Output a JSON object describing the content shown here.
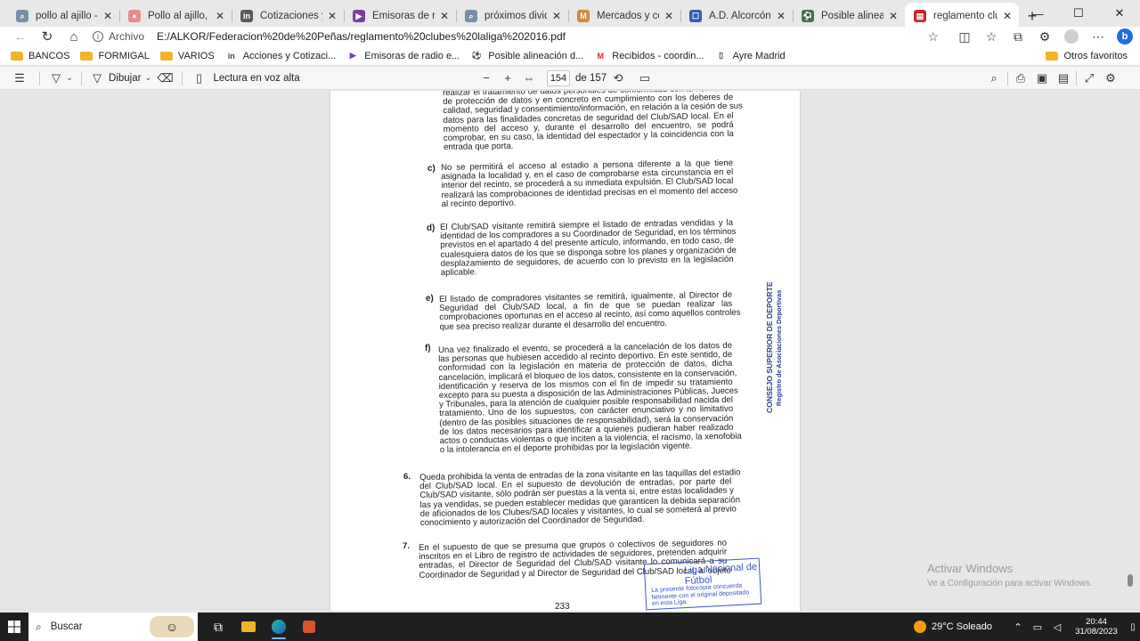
{
  "tabs": [
    {
      "label": "pollo al ajillo - Búsqueda",
      "icon": "search-icon",
      "favcolor": "#7a8fa6",
      "glyph": "⌕"
    },
    {
      "label": "Pollo al ajillo, receta ca",
      "icon": "recipe-site-icon",
      "favcolor": "#e98b8b",
      "glyph": "●"
    },
    {
      "label": "Cotizaciones y Precios",
      "icon": "investing-icon",
      "favcolor": "#5a5a5a",
      "glyph": "in"
    },
    {
      "label": "Emisoras de radio",
      "icon": "radio-icon",
      "favcolor": "#7b3fa0",
      "glyph": "▶"
    },
    {
      "label": "próximos dividendos",
      "icon": "search-icon",
      "favcolor": "#7a8fa6",
      "glyph": "⌕"
    },
    {
      "label": "Mercados y cotizaciones",
      "icon": "markets-icon",
      "favcolor": "#d08a3a",
      "glyph": "M"
    },
    {
      "label": "A.D. Alcorcón (no oficial)",
      "icon": "forum-icon",
      "favcolor": "#2f5fb3",
      "glyph": "☐"
    },
    {
      "label": "Posible alineación del",
      "icon": "soccer-ball-icon",
      "favcolor": "#3b7a3b",
      "glyph": "⚽"
    },
    {
      "label": "reglamento clubes laliga",
      "icon": "pdf-icon",
      "favcolor": "#c62828",
      "glyph": "▤"
    }
  ],
  "window_controls": {
    "minimize": "—",
    "maximize": "☐",
    "close": "✕"
  },
  "address": {
    "scheme": "Archivo",
    "url": "E:/ALKOR/Federacion%20de%20Peñas/reglamento%20clubes%20laliga%202016.pdf"
  },
  "bookmarks": [
    {
      "label": "BANCOS",
      "icon": "folder-icon"
    },
    {
      "label": "FORMIGAL",
      "icon": "folder-icon"
    },
    {
      "label": "VARIOS",
      "icon": "folder-icon"
    },
    {
      "label": "Acciones y Cotizaci...",
      "icon": "investing-icon"
    },
    {
      "label": "Emisoras de radio e...",
      "icon": "radio-icon"
    },
    {
      "label": "Posible alineación d...",
      "icon": "soccer-ball-icon"
    },
    {
      "label": "Recibidos - coordin...",
      "icon": "gmail-icon"
    },
    {
      "label": "Ayre Madrid",
      "icon": "page-icon"
    }
  ],
  "other_bookmarks": "Otros favoritos",
  "pdf_toolbar": {
    "draw_label": "Dibujar",
    "read_aloud_label": "Lectura en voz alta",
    "current_page": "154",
    "total_pages": "de 157"
  },
  "document": {
    "para_b_tail": [
      "realizar el tratamiento de datos personales de conformidad con la normativa",
      "de protección de datos y en concreto en cumplimiento con los deberes de",
      "calidad, seguridad y consentimiento/información, en relación a la cesión de sus",
      "datos para las finalidades concretas de seguridad del Club/SAD local. En el",
      "momento del acceso y, durante el desarrollo del encuentro, se podrá",
      "comprobar, en su caso, la identidad del espectador y la coincidencia con la",
      "entrada que porta."
    ],
    "c_label": "c)",
    "c_lines": [
      "No se permitirá el acceso al estadio a persona diferente a la que tiene",
      "asignada la localidad y, en el caso de comprobarse esta circunstancia en el",
      "interior del recinto, se procederá a su inmediata expulsión. El Club/SAD local",
      "realizará las comprobaciones de identidad precisas en el momento del acceso",
      "al recinto deportivo."
    ],
    "d_label": "d)",
    "d_lines": [
      "El Club/SAD visitante remitirá siempre el listado de entradas vendidas y la",
      "identidad de los compradores a su Coordinador de Seguridad, en los términos",
      "previstos en el apartado 4 del presente artículo, informando, en todo caso, de",
      "cualesquiera datos de los que se disponga sobre los planes y organización de",
      "desplazamiento de seguidores, de acuerdo con lo previsto en la legislación",
      "aplicable."
    ],
    "e_label": "e)",
    "e_lines": [
      "El listado de compradores visitantes se remitirá, igualmente, al Director de",
      "Seguridad del Club/SAD local, a fin de que se puedan realizar las",
      "comprobaciones oportunas en el acceso al recinto, así como aquellos controles",
      "que sea preciso realizar durante el desarrollo del encuentro."
    ],
    "f_label": "f)",
    "f_lines": [
      "Una vez finalizado el evento, se procederá a la cancelación de los datos de",
      "las personas que hubiesen accedido al recinto deportivo. En este sentido, de",
      "conformidad con la legislación en materia de protección de datos, dicha",
      "cancelación, implicará el bloqueo de los datos, consistente en la conservación,",
      "identificación y reserva de los mismos con el fin de impedir su tratamiento",
      "excepto para su puesta a disposición de las Administraciones Públicas, Jueces",
      "y Tribunales, para la atención de cualquier posible responsabilidad nacida del",
      "tratamiento. Uno de los supuestos, con carácter enunciativo y no limitativo",
      "(dentro de las posibles situaciones de responsabilidad), será la conservación",
      "de los datos necesarios para identificar a quienes pudieran haber realizado",
      "actos o conductas violentas o que inciten a la violencia, el racismo, la xenofobia",
      "o la intolerancia en el deporte prohibidas por la legislación vigente."
    ],
    "p6_label": "6.",
    "p6_lines": [
      "Queda prohibida la venta de entradas de la zona visitante en las taquillas del estadio",
      "del Club/SAD local. En el supuesto de devolución de entradas, por parte del",
      "Club/SAD visitante, sólo podrán ser puestas a la venta si, entre estas localidades y",
      "las ya vendidas, se pueden establecer medidas que garanticen la debida separación",
      "de aficionados de los Clubes/SAD locales y visitantes, lo cual se someterá al previo",
      "conocimiento y autorización del Coordinador de Seguridad."
    ],
    "p7_label": "7.",
    "p7_lines": [
      "En el supuesto de que se presuma que grupos o colectivos de seguidores no",
      "inscritos en el Libro de registro de actividades de seguidores, pretenden adquirir",
      "entradas, el Director de Seguridad del Club/SAD visitante lo comunicará a su",
      "Coordinador de Seguridad y al Director de Seguridad del Club/SAD local, al objeto"
    ],
    "side_stamp_line1": "CONSEJO SUPERIOR DE DEPORTES",
    "side_stamp_line2": "Registro de Asociaciones Deportivas",
    "blue_stamp_title": "Liga Nacional de Fútbol",
    "blue_stamp_body": "La presente fotocopia concuerda fielmente con el original depositado en esta Liga.",
    "page_number": "233"
  },
  "watermark": {
    "title": "Activar Windows",
    "subtitle": "Ve a Configuración para activar Windows."
  },
  "taskbar": {
    "search_label": "Buscar",
    "weather": "29°C  Soleado",
    "time": "20:44",
    "date": "31/08/2023"
  }
}
